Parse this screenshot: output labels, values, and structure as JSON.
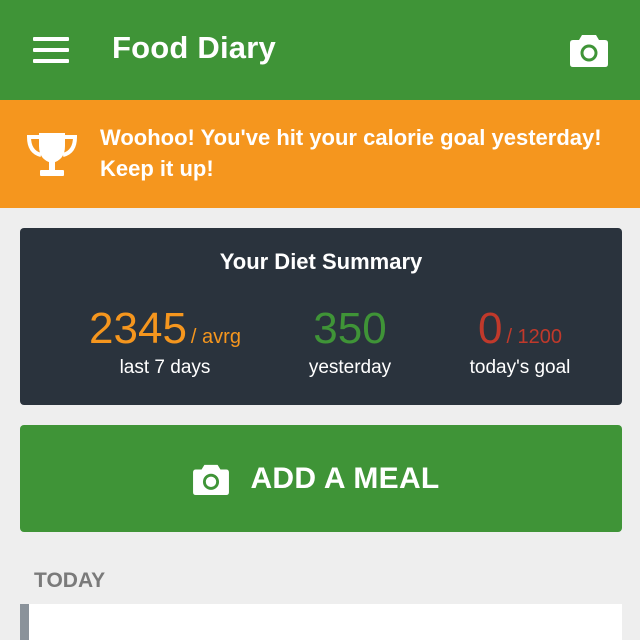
{
  "app_bar": {
    "title": "Food Diary",
    "menu_icon": "hamburger-menu-icon",
    "camera_icon": "camera-icon",
    "background_color": "#3f9437"
  },
  "banner": {
    "icon": "trophy-icon",
    "message": "Woohoo! You've hit your calorie goal yesterday! Keep it up!",
    "background_color": "#f5961e"
  },
  "summary": {
    "title": "Your Diet Summary",
    "stats": [
      {
        "value": "2345",
        "unit": "/ avrg",
        "label": "last 7 days",
        "color": "#f5961e"
      },
      {
        "value": "350",
        "unit": "",
        "label": "yesterday",
        "color": "#3f9437"
      },
      {
        "value": "0",
        "unit": "/ 1200",
        "label": "today's goal",
        "color": "#c0392b"
      }
    ],
    "background_color": "#2a333d"
  },
  "add_meal": {
    "label": "ADD A MEAL",
    "icon": "camera-icon"
  },
  "today": {
    "header": "TODAY"
  }
}
